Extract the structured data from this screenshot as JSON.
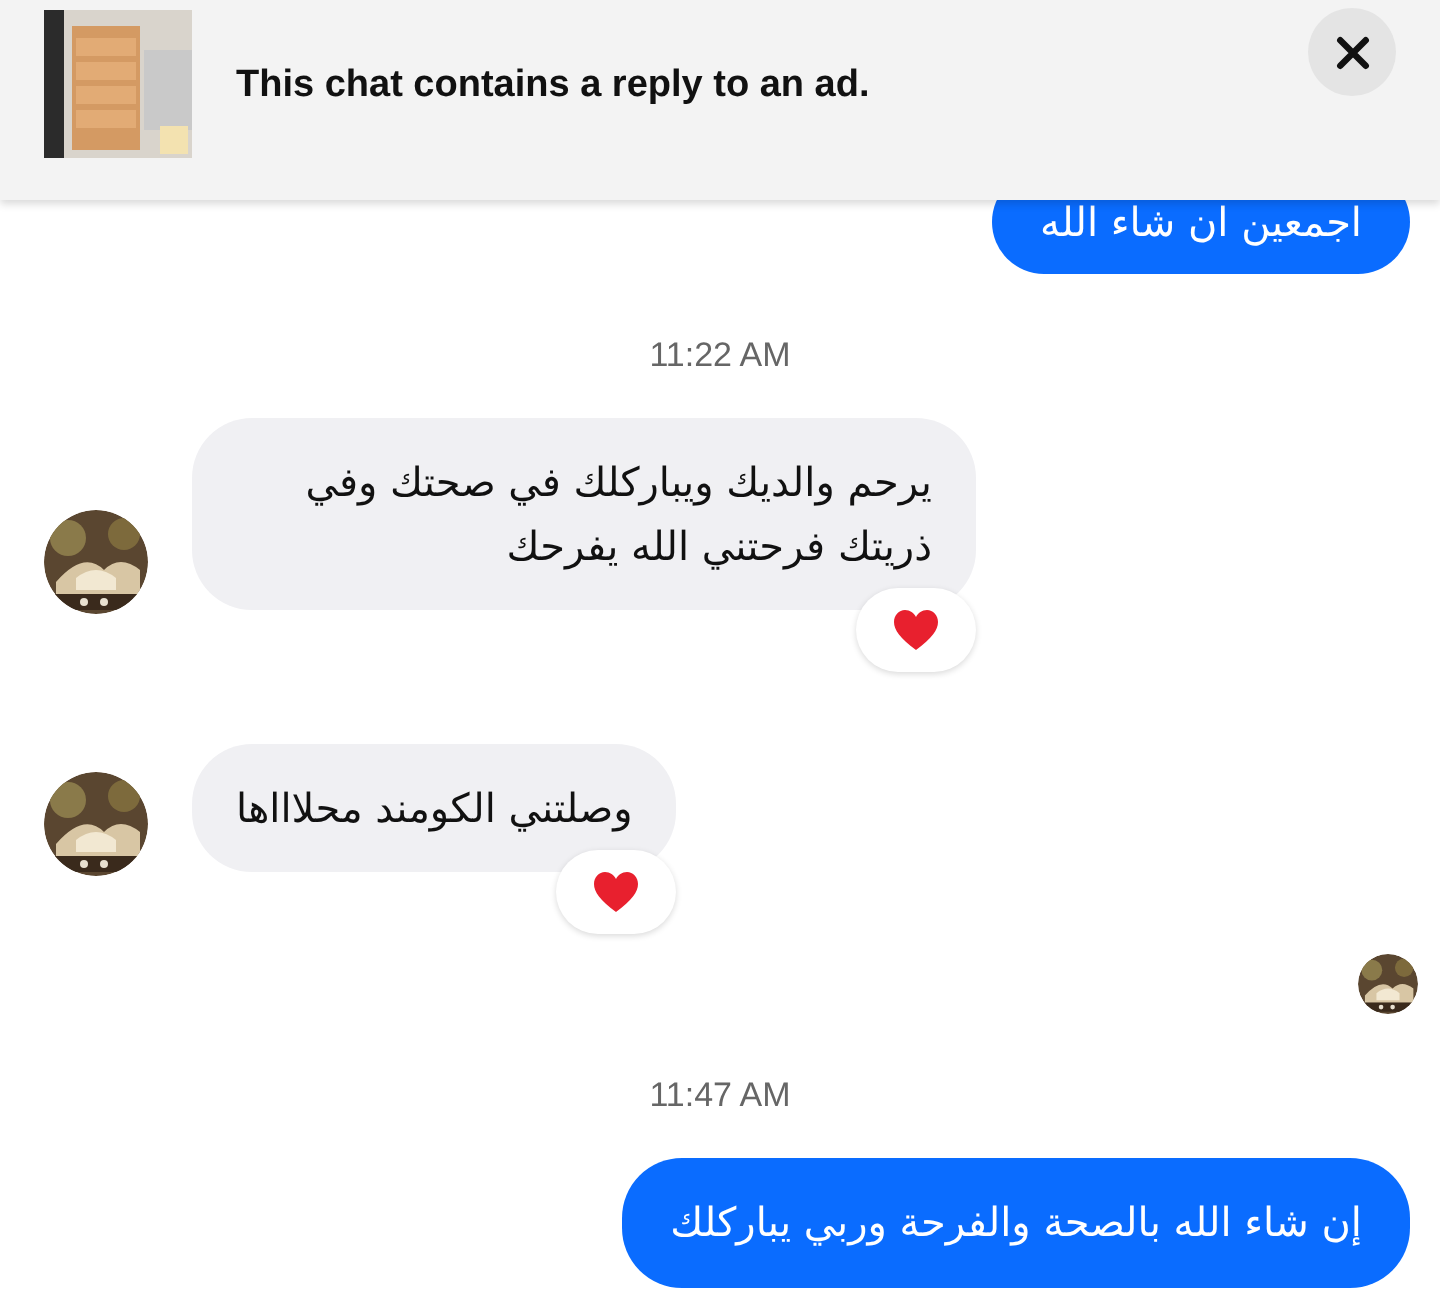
{
  "banner": {
    "text": "This chat contains a reply to an ad."
  },
  "messages": [
    {
      "kind": "outgoing",
      "text": "اجمعين ان شاء الله"
    },
    {
      "kind": "timestamp",
      "text": "11:22 AM"
    },
    {
      "kind": "incoming",
      "text": "يرحم والديك ويباركلك في صحتك وفي ذريتك فرحتني الله يفرحك",
      "hearted": true
    },
    {
      "kind": "incoming",
      "text": "وصلتني الكومند محلاااها",
      "hearted": true
    },
    {
      "kind": "seen"
    },
    {
      "kind": "timestamp",
      "text": "11:47 AM"
    },
    {
      "kind": "outgoing",
      "text": "إن شاء الله بالصحة والفرحة وربي يباركلك"
    }
  ]
}
